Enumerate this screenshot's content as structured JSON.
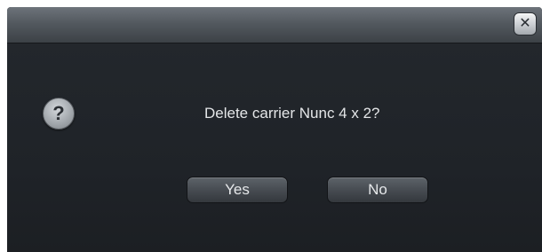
{
  "dialog": {
    "close_glyph": "✕",
    "close_icon": "close-icon",
    "icon": "question-icon",
    "icon_glyph": "?",
    "message": "Delete carrier Nunc 4 x 2?",
    "buttons": {
      "yes_label": "Yes",
      "no_label": "No"
    }
  },
  "colors": {
    "dialog_background": "#1f2226",
    "titlebar": "#53595f",
    "button": "#474c52",
    "text": "#e4e6e8"
  }
}
